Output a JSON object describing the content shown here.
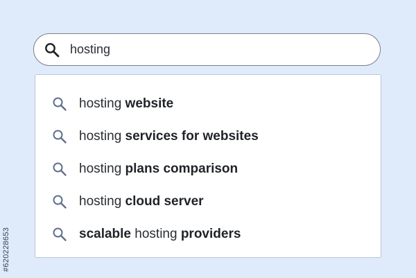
{
  "search": {
    "value": "hosting",
    "icon": "search-icon"
  },
  "suggestions": [
    {
      "parts": [
        {
          "text": "hosting ",
          "bold": false
        },
        {
          "text": "website",
          "bold": true
        }
      ]
    },
    {
      "parts": [
        {
          "text": "hosting ",
          "bold": false
        },
        {
          "text": "services for websites",
          "bold": true
        }
      ]
    },
    {
      "parts": [
        {
          "text": "hosting ",
          "bold": false
        },
        {
          "text": "plans comparison",
          "bold": true
        }
      ]
    },
    {
      "parts": [
        {
          "text": "hosting ",
          "bold": false
        },
        {
          "text": "cloud server",
          "bold": true
        }
      ]
    },
    {
      "parts": [
        {
          "text": "scalable",
          "bold": true
        },
        {
          "text": " hosting ",
          "bold": false
        },
        {
          "text": "providers",
          "bold": true
        }
      ]
    }
  ],
  "credit": {
    "id": "#620228653"
  },
  "colors": {
    "background": "#dfeafb",
    "suggestion_icon": "#5f6f8f",
    "search_icon": "#202124"
  }
}
